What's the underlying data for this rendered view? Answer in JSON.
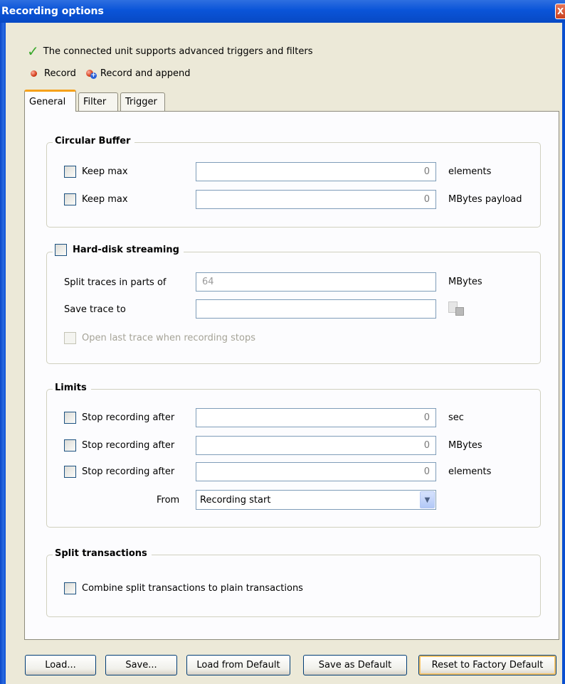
{
  "window": {
    "title": "Recording options",
    "close_label": "X"
  },
  "status": {
    "message": "The connected unit supports advanced triggers and filters",
    "record_label": "Record",
    "record_append_label": "Record and append"
  },
  "tabs": [
    {
      "label": "General",
      "active": true
    },
    {
      "label": "Filter",
      "active": false
    },
    {
      "label": "Trigger",
      "active": false
    }
  ],
  "circular_buffer": {
    "title": "Circular Buffer",
    "rows": [
      {
        "label": "Keep max",
        "value": "0",
        "unit": "elements"
      },
      {
        "label": "Keep max",
        "value": "0",
        "unit": "MBytes payload"
      }
    ]
  },
  "hard_disk": {
    "title": "Hard-disk streaming",
    "split_label": "Split traces in parts of",
    "split_value": "64",
    "split_unit": "MBytes",
    "save_label": "Save trace to",
    "save_value": "",
    "open_last_label": "Open last trace when recording stops"
  },
  "limits": {
    "title": "Limits",
    "rows": [
      {
        "label": "Stop recording after",
        "value": "0",
        "unit": "sec"
      },
      {
        "label": "Stop recording after",
        "value": "0",
        "unit": "MBytes"
      },
      {
        "label": "Stop recording after",
        "value": "0",
        "unit": "elements"
      }
    ],
    "from_label": "From",
    "from_value": "Recording start"
  },
  "split_transactions": {
    "title": "Split transactions",
    "combine_label": "Combine split transactions to plain transactions"
  },
  "buttons": {
    "load": "Load...",
    "save": "Save...",
    "load_default": "Load from Default",
    "save_default": "Save as Default",
    "reset_factory": "Reset to Factory Default"
  }
}
